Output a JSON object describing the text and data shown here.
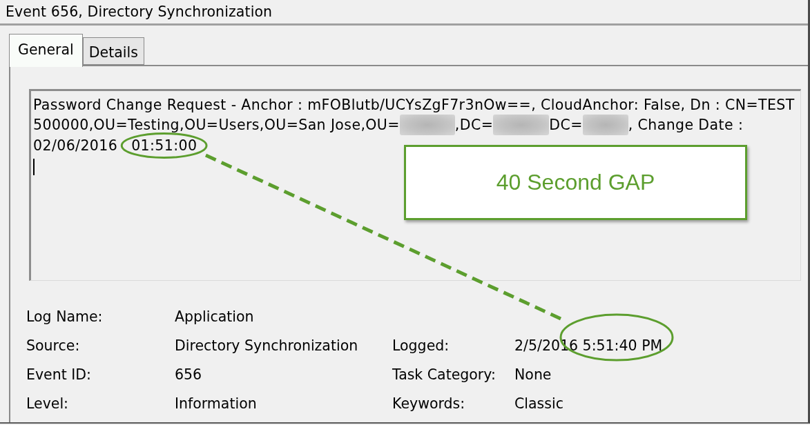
{
  "window": {
    "title": "Event 656, Directory Synchronization"
  },
  "tabs": [
    {
      "label": "General",
      "selected": true
    },
    {
      "label": "Details",
      "selected": false
    }
  ],
  "message": {
    "lines": [
      [
        {
          "kind": "text",
          "text": "Password Change Request - Anchor : mFOBlutb/UCYsZgF7r3nOw==, CloudAnchor: False, Dn : CN=TEST"
        }
      ],
      [
        {
          "kind": "text",
          "text": "500000,OU=Testing,OU=Users,OU=San Jose,OU="
        },
        {
          "kind": "redacted"
        },
        {
          "kind": "text",
          "text": ",DC="
        },
        {
          "kind": "redacted"
        },
        {
          "kind": "text",
          "text": "DC="
        },
        {
          "kind": "redacted"
        },
        {
          "kind": "text",
          "text": ", Change Date :"
        }
      ],
      [
        {
          "kind": "text",
          "text": "02/06/2016"
        },
        {
          "kind": "circled",
          "text": "01:51:00"
        }
      ]
    ],
    "cursor_visible": true
  },
  "fields": [
    [
      {
        "label": "Log Name:",
        "value": "Application"
      }
    ],
    [
      {
        "label": "Source:",
        "value": "Directory Synchronization"
      },
      {
        "label": "Logged:",
        "value": "2/5/2016 5:51:40 PM"
      }
    ],
    [
      {
        "label": "Event ID:",
        "value": "656"
      },
      {
        "label": "Task Category:",
        "value": "None"
      }
    ],
    [
      {
        "label": "Level:",
        "value": "Information"
      },
      {
        "label": "Keywords:",
        "value": "Classic"
      }
    ]
  ],
  "annotation": {
    "callout": "40 Second GAP"
  }
}
